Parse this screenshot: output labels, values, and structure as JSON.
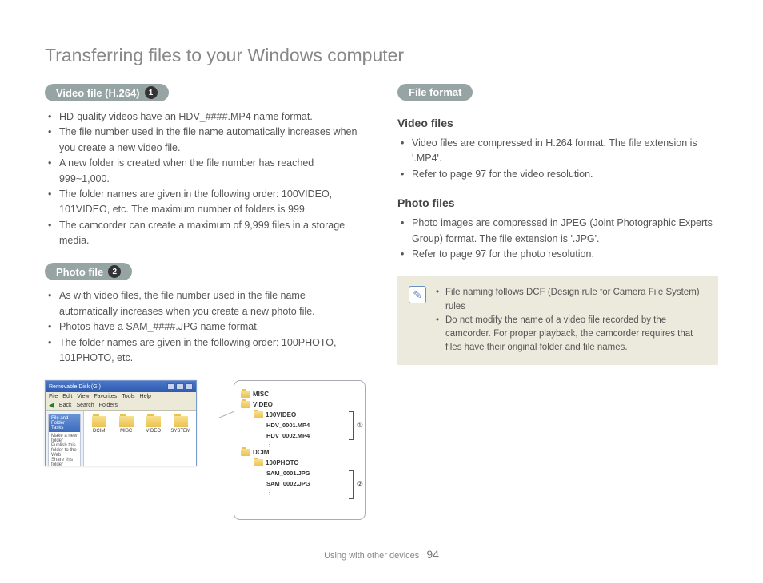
{
  "title": "Transferring files to your Windows computer",
  "left": {
    "videoPill": "Video file (H.264)",
    "videoNum": "1",
    "videoBullets": [
      "HD-quality videos have an HDV_####.MP4 name format.",
      "The file number used in the file name automatically increases when you create a new video file.",
      "A new folder is created when the file number has reached 999~1,000.",
      "The folder names are given in the following order: 100VIDEO, 101VIDEO, etc. The maximum number of folders  is 999.",
      "The camcorder can create a maximum of 9,999 files in a storage media."
    ],
    "photoPill": "Photo file",
    "photoNum": "2",
    "photoBullets": [
      "As with video files, the file number used in the file name automatically increases when you create a new photo file.",
      "Photos have a SAM_####.JPG name format.",
      "The folder names are given in the following order: 100PHOTO, 101PHOTO, etc."
    ]
  },
  "right": {
    "formatPill": "File format",
    "videoHead": "Video files",
    "videoBullets": [
      "Video files are compressed in H.264 format. The file extension is '.MP4'.",
      "Refer to page 97 for the video resolution."
    ],
    "photoHead": "Photo files",
    "photoBullets": [
      "Photo images are compressed in JPEG (Joint Photographic Experts Group) format. The file extension is '.JPG'.",
      "Refer to page 97 for the photo resolution."
    ],
    "notes": [
      "File naming follows DCF (Design rule for Camera File System) rules",
      "Do not modify the name of a video file recorded by the camcorder. For proper playback, the camcorder requires that files have their original folder and file names."
    ]
  },
  "explorer": {
    "title": "Removable Disk (G:)",
    "menu": [
      "File",
      "Edit",
      "View",
      "Favorites",
      "Tools",
      "Help"
    ],
    "back": "Back",
    "search": "Search",
    "foldersBtn": "Folders",
    "panelHd": "File and Folder Tasks",
    "panelItems": [
      "Make a new folder",
      "Publish this folder to the Web",
      "Share this folder"
    ],
    "folders": [
      "DCIM",
      "MISC",
      "VIDEO",
      "SYSTEM"
    ]
  },
  "tree": {
    "n0": "MISC",
    "n1": "VIDEO",
    "n1a": "100VIDEO",
    "f1": "HDV_0001.MP4",
    "f2": "HDV_0002.MP4",
    "n2": "DCIM",
    "n2a": "100PHOTO",
    "f3": "SAM_0001.JPG",
    "f4": "SAM_0002.JPG",
    "marker1": "①",
    "marker2": "②"
  },
  "footer": {
    "section": "Using with other devices",
    "page": "94"
  }
}
